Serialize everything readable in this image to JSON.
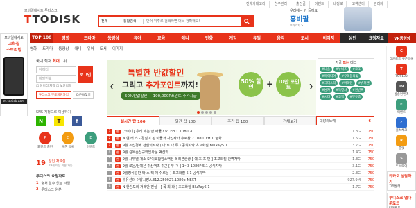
{
  "topbar": {
    "items": [
      "전체카테고리",
      "친구관리",
      "출전금",
      "이벤트",
      "내정보",
      "고객센터",
      "관리자"
    ]
  },
  "logo": {
    "subtitle": "모바일에서도 투디스크",
    "name": "TODISK"
  },
  "search": {
    "select1": "전체",
    "select2": "통합검색",
    "placeholder": "단어 뒤주로 검색하면 더욱 정확해요!"
  },
  "ad_top": {
    "line1": "우리에는 안 들어요",
    "line2": "흥비팔",
    "line3": "보러가기 >"
  },
  "nav": {
    "items": [
      "TOP 100",
      "영화",
      "드라마",
      "동영상",
      "유아",
      "교육",
      "애니",
      "만화",
      "게임",
      "유틸",
      "음악",
      "도서",
      "이미지",
      "성인",
      "요청자료"
    ]
  },
  "subnav": {
    "items": [
      "영화",
      "드라마",
      "동영상",
      "애니",
      "유아",
      "도서",
      "이미지"
    ]
  },
  "vr": "VR동영상",
  "left_banner": {
    "line1": "모바일에서도",
    "line2": "고화질",
    "line3": "스트리밍",
    "url": "m.todisk.com"
  },
  "login": {
    "title_pre": "국내 최저",
    "title_hl": "최대",
    "title_post": "1위",
    "id_placeholder": "아이디",
    "pw_placeholder": "비밀번호",
    "login_btn": "로그인",
    "save_id": "아이디 저장",
    "safe": "보안접속",
    "join": "투디스크 무료회원가입",
    "find": "ID/PW찾기"
  },
  "sns": {
    "title": "SNS 계정으로 이용하기",
    "items": [
      "N",
      "T",
      "f"
    ]
  },
  "quick": [
    {
      "label": "포인트 충전",
      "icon": "P"
    },
    {
      "label": "쿠폰 등록",
      "icon": "C"
    },
    {
      "label": "이벤트",
      "icon": "E"
    }
  ],
  "event": {
    "num": "19",
    "text": "성인 자료실",
    "sub": "19세 이상 이용 가능"
  },
  "ranking": {
    "title": "투디스크 요청자료",
    "rows": [
      {
        "num": "1",
        "title": "출처 알수 없는 파일"
      },
      {
        "num": "2",
        "title": "투디스크 원본"
      }
    ]
  },
  "banner": {
    "line1_a": "특별한 ",
    "line1_b": "반값할인",
    "line2_a": "그리고 ",
    "line2_b": "추가포인트",
    "line2_c": "까지!",
    "line3": "50%반값할인 + 100,000P포인트 추가지급",
    "circle1": "50% 할인",
    "circle2": "10만 포인트"
  },
  "tags": {
    "title_pre": "지금 ",
    "title_hl": "뜨는",
    "title_post": " 태그",
    "items": [
      "#나솔",
      "#뉴비즈",
      "#로또",
      "#아이디어",
      "#우리들의빛",
      "#국대스타",
      "#마리텐",
      "#슈퍼맨",
      "#남자",
      "#특전사",
      "#원반찌",
      "#시대",
      "#코막",
      "#부유층"
    ]
  },
  "tabs": {
    "items": [
      "실시간 탑 100",
      "일간 탑 100",
      "주간 탑 100",
      "전체보기"
    ]
  },
  "rtab": {
    "label": "대장의노예",
    "count": "6"
  },
  "list": [
    {
      "num": "1",
      "cat": "한",
      "title": "[코미디] 우리 애는 안 애물어요. FHD. 1080 ㅋ",
      "size": "1.3G",
      "pt": "750"
    },
    {
      "num": "2",
      "cat": "한",
      "title": "N 헨 터 스 - 경찰이 된 아들과 사진작가 추억찾다 1080. FHD. 영화",
      "size": "1.5G",
      "pt": "750"
    },
    {
      "num": "3",
      "cat": "한",
      "title": "9월 조선경제 전설의서작 ( 아 토 나 루 ) 공식자막 초고화질 BluRay5.1",
      "size": "3.7G",
      "pt": "750"
    },
    {
      "num": "4",
      "cat": "한",
      "title": "9월 길복순신규학입사운 액션외",
      "size": "1.4G",
      "pt": "750"
    },
    {
      "num": "5",
      "cat": "한",
      "title": "9월 사무엘,개소 SF이료합암소액션 복리본쿵쿵 [ 쉐 즈 프 먼 ] 초고화질 완벽자막",
      "size": "1.3G",
      "pt": "750"
    },
    {
      "num": "6",
      "cat": "한",
      "title": "9월 로운/신예은 쥐산액즈 쥐근 [ 두 ㅋ ] 1~3 1080P 5.1 공식자막",
      "size": "3.1G",
      "pt": "750"
    },
    {
      "num": "7",
      "cat": "한",
      "title": "9월정식 [ 판 타 스 틱 애 쉬로운 ] 초고화질 5.1 공식자막",
      "size": "2.3G",
      "pt": "750"
    },
    {
      "num": "8",
      "cat": "한",
      "title": "수유선의 이방시장A.E12.250927.1080p-NEXT",
      "size": "927.9M",
      "pt": "750"
    },
    {
      "num": "9",
      "cat": "한",
      "title": "N 한반도의 거래만 진실 - [ 폭 최 화 ] 초고화질 BluRay5.1",
      "size": "1.7G",
      "pt": "750"
    }
  ],
  "right": {
    "items": [
      {
        "label": "다운로드 쿠폰등록",
        "icon": "C",
        "color": "#e8331a"
      },
      {
        "label": "TOP100",
        "icon": "T",
        "color": "#e8331a"
      },
      {
        "label": "방송컨텐츠",
        "icon": "TV",
        "color": "#555"
      },
      {
        "label": "이벤트",
        "icon": "E",
        "color": "#3d9e7d"
      },
      {
        "label": "출석체크",
        "icon": "✓",
        "color": "#2f6fd1"
      },
      {
        "label": "룰렛",
        "icon": "R",
        "color": "#f39c12"
      },
      {
        "label": "투스토어",
        "icon": "S",
        "color": "#999"
      }
    ],
    "ad1": {
      "title": "카카오 상담하기",
      "sub": "고객센터"
    },
    "ad2": {
      "title": "투디스크 앱다운로드",
      "sub": "다운로드"
    }
  },
  "colors": {
    "brand": "#e8331a",
    "nav_dark": "#c2210c"
  }
}
